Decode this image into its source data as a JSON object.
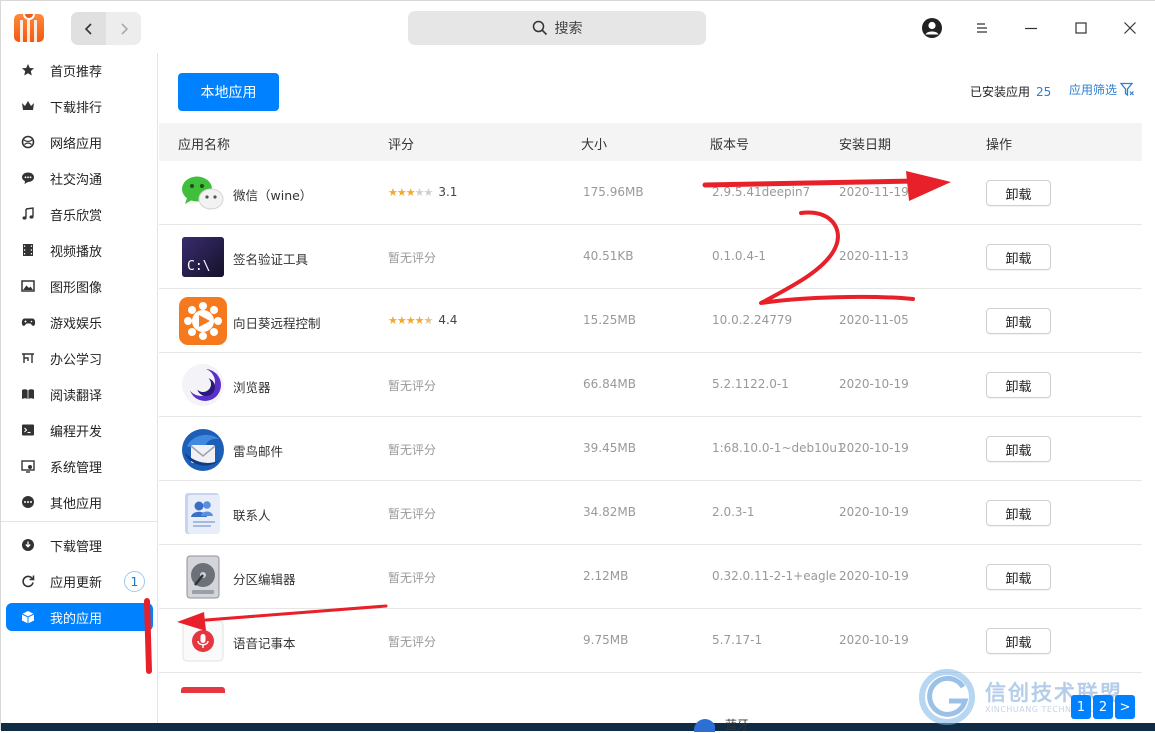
{
  "titlebar": {
    "search_label": "搜索"
  },
  "sidebar": {
    "items": [
      {
        "label": "首页推荐",
        "icon": "star-icon"
      },
      {
        "label": "下载排行",
        "icon": "crown-icon"
      },
      {
        "label": "网络应用",
        "icon": "globe-icon"
      },
      {
        "label": "社交沟通",
        "icon": "chat-icon"
      },
      {
        "label": "音乐欣赏",
        "icon": "music-icon"
      },
      {
        "label": "视频播放",
        "icon": "film-icon"
      },
      {
        "label": "图形图像",
        "icon": "image-icon"
      },
      {
        "label": "游戏娱乐",
        "icon": "gamepad-icon"
      },
      {
        "label": "办公学习",
        "icon": "desk-icon"
      },
      {
        "label": "阅读翻译",
        "icon": "book-icon"
      },
      {
        "label": "编程开发",
        "icon": "terminal-icon"
      },
      {
        "label": "系统管理",
        "icon": "monitor-icon"
      },
      {
        "label": "其他应用",
        "icon": "more-icon"
      }
    ],
    "bottom_items": [
      {
        "label": "下载管理",
        "icon": "download-icon"
      },
      {
        "label": "应用更新",
        "icon": "refresh-icon",
        "badge": "1"
      },
      {
        "label": "我的应用",
        "icon": "box-icon",
        "active": true
      }
    ]
  },
  "main": {
    "local_apps_button": "本地应用",
    "installed_label": "已安装应用",
    "installed_count": "25",
    "filter_label": "应用筛选",
    "columns": [
      "应用名称",
      "评分",
      "大小",
      "版本号",
      "安装日期",
      "操作"
    ],
    "rows": [
      {
        "name": "微信（wine）",
        "rating": "3.1",
        "stars": 3,
        "size": "175.96MB",
        "version": "2.9.5.41deepin7",
        "date": "2020-11-19",
        "action": "卸载",
        "icon": "wechat-icon"
      },
      {
        "name": "签名验证工具",
        "rating": "暂无评分",
        "size": "40.51KB",
        "version": "0.1.0.4-1",
        "date": "2020-11-13",
        "action": "卸载",
        "icon": "terminal-app-icon"
      },
      {
        "name": "向日葵远程控制",
        "rating": "4.4",
        "stars": 4.5,
        "size": "15.25MB",
        "version": "10.0.2.24779",
        "date": "2020-11-05",
        "action": "卸载",
        "icon": "sunflower-icon"
      },
      {
        "name": "浏览器",
        "rating": "暂无评分",
        "size": "66.84MB",
        "version": "5.2.1122.0-1",
        "date": "2020-10-19",
        "action": "卸载",
        "icon": "browser-icon"
      },
      {
        "name": "雷鸟邮件",
        "rating": "暂无评分",
        "size": "39.45MB",
        "version": "1:68.10.0-1~deb10u1",
        "date": "2020-10-19",
        "action": "卸载",
        "icon": "thunderbird-icon"
      },
      {
        "name": "联系人",
        "rating": "暂无评分",
        "size": "34.82MB",
        "version": "2.0.3-1",
        "date": "2020-10-19",
        "action": "卸载",
        "icon": "contacts-icon"
      },
      {
        "name": "分区编辑器",
        "rating": "暂无评分",
        "size": "2.12MB",
        "version": "0.32.0.11-2-1+eagle",
        "date": "2020-10-19",
        "action": "卸载",
        "icon": "disk-icon"
      },
      {
        "name": "语音记事本",
        "rating": "暂无评分",
        "size": "9.75MB",
        "version": "5.7.17-1",
        "date": "2020-10-19",
        "action": "卸载",
        "icon": "voice-note-icon"
      }
    ],
    "pages": [
      "1",
      "2",
      ">"
    ]
  },
  "watermark": {
    "title": "信创技术联盟",
    "subtitle": "XINCHUANG TECHNOLOGY"
  },
  "taskbar": {
    "peek_label": "蓝牙"
  },
  "colors": {
    "accent": "#0081ff",
    "annotation": "#e8202a"
  }
}
